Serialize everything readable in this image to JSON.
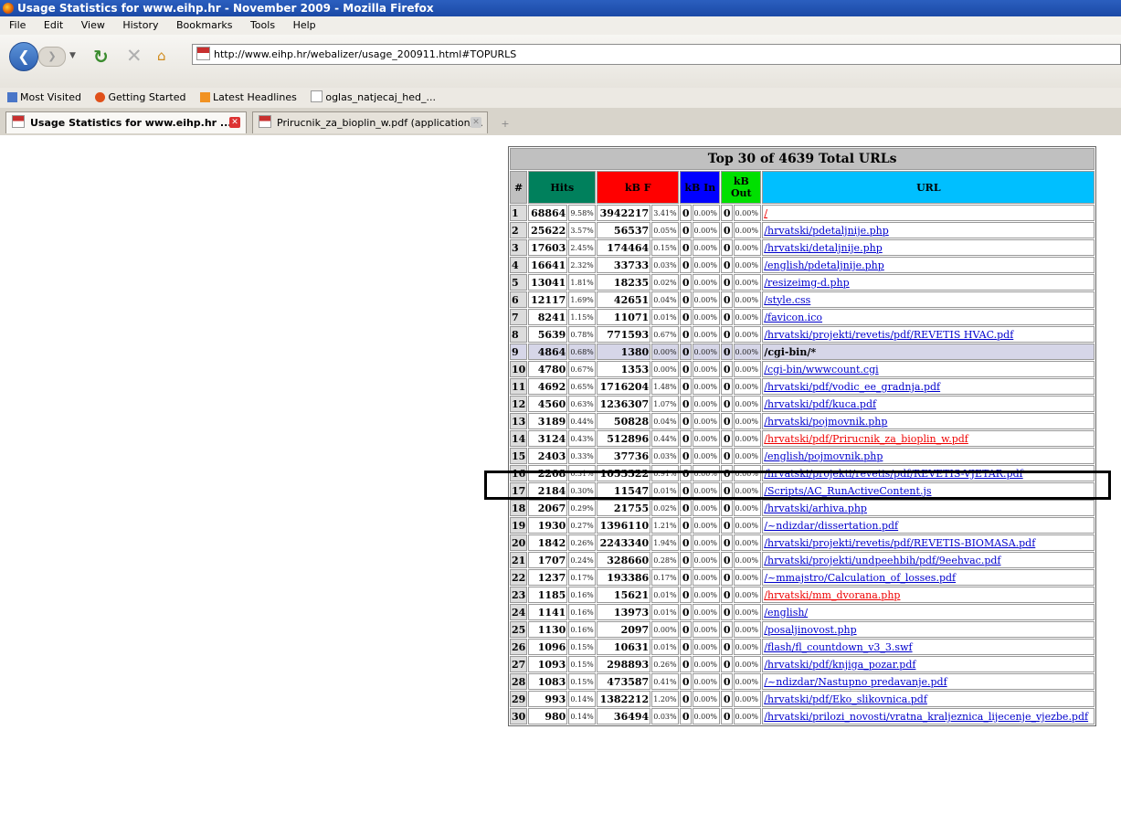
{
  "window": {
    "title": "Usage Statistics for www.eihp.hr - November 2009 - Mozilla Firefox"
  },
  "menu": [
    "File",
    "Edit",
    "View",
    "History",
    "Bookmarks",
    "Tools",
    "Help"
  ],
  "nav": {
    "url": "http://www.eihp.hr/webalizer/usage_200911.html#TOPURLS"
  },
  "bookmarks": [
    "Most Visited",
    "Getting Started",
    "Latest Headlines",
    "oglas_natjecaj_hed_..."
  ],
  "tabs": [
    {
      "label": "Usage Statistics for www.eihp.hr ...",
      "active": true
    },
    {
      "label": "Prirucnik_za_bioplin_w.pdf (application/...",
      "active": false
    }
  ],
  "newtab": "+",
  "table": {
    "caption": "Top 30 of 4639 Total URLs",
    "headers": {
      "num": "#",
      "hits": "Hits",
      "kbf": "kB F",
      "kbin": "kB In",
      "kbout": "kB Out",
      "url": "URL"
    },
    "rows": [
      {
        "n": "1",
        "hits": "68864",
        "hp": "9.58%",
        "kbf": "3942217",
        "kp": "3.41%",
        "in": "0",
        "ip": "0.00%",
        "out": "0",
        "op": "0.00%",
        "url": "/",
        "red": true
      },
      {
        "n": "2",
        "hits": "25622",
        "hp": "3.57%",
        "kbf": "56537",
        "kp": "0.05%",
        "in": "0",
        "ip": "0.00%",
        "out": "0",
        "op": "0.00%",
        "url": "/hrvatski/pdetaljnije.php"
      },
      {
        "n": "3",
        "hits": "17603",
        "hp": "2.45%",
        "kbf": "174464",
        "kp": "0.15%",
        "in": "0",
        "ip": "0.00%",
        "out": "0",
        "op": "0.00%",
        "url": "/hrvatski/detaljnije.php"
      },
      {
        "n": "4",
        "hits": "16641",
        "hp": "2.32%",
        "kbf": "33733",
        "kp": "0.03%",
        "in": "0",
        "ip": "0.00%",
        "out": "0",
        "op": "0.00%",
        "url": "/english/pdetaljnije.php"
      },
      {
        "n": "5",
        "hits": "13041",
        "hp": "1.81%",
        "kbf": "18235",
        "kp": "0.02%",
        "in": "0",
        "ip": "0.00%",
        "out": "0",
        "op": "0.00%",
        "url": "/resizeimg-d.php"
      },
      {
        "n": "6",
        "hits": "12117",
        "hp": "1.69%",
        "kbf": "42651",
        "kp": "0.04%",
        "in": "0",
        "ip": "0.00%",
        "out": "0",
        "op": "0.00%",
        "url": "/style.css"
      },
      {
        "n": "7",
        "hits": "8241",
        "hp": "1.15%",
        "kbf": "11071",
        "kp": "0.01%",
        "in": "0",
        "ip": "0.00%",
        "out": "0",
        "op": "0.00%",
        "url": "/favicon.ico"
      },
      {
        "n": "8",
        "hits": "5639",
        "hp": "0.78%",
        "kbf": "771593",
        "kp": "0.67%",
        "in": "0",
        "ip": "0.00%",
        "out": "0",
        "op": "0.00%",
        "url": "/hrvatski/projekti/revetis/pdf/REVETIS HVAC.pdf"
      },
      {
        "n": "9",
        "hits": "4864",
        "hp": "0.68%",
        "kbf": "1380",
        "kp": "0.00%",
        "in": "0",
        "ip": "0.00%",
        "out": "0",
        "op": "0.00%",
        "url": "/cgi-bin/*",
        "grey": true
      },
      {
        "n": "10",
        "hits": "4780",
        "hp": "0.67%",
        "kbf": "1353",
        "kp": "0.00%",
        "in": "0",
        "ip": "0.00%",
        "out": "0",
        "op": "0.00%",
        "url": "/cgi-bin/wwwcount.cgi"
      },
      {
        "n": "11",
        "hits": "4692",
        "hp": "0.65%",
        "kbf": "1716204",
        "kp": "1.48%",
        "in": "0",
        "ip": "0.00%",
        "out": "0",
        "op": "0.00%",
        "url": "/hrvatski/pdf/vodic_ee_gradnja.pdf"
      },
      {
        "n": "12",
        "hits": "4560",
        "hp": "0.63%",
        "kbf": "1236307",
        "kp": "1.07%",
        "in": "0",
        "ip": "0.00%",
        "out": "0",
        "op": "0.00%",
        "url": "/hrvatski/pdf/kuca.pdf"
      },
      {
        "n": "13",
        "hits": "3189",
        "hp": "0.44%",
        "kbf": "50828",
        "kp": "0.04%",
        "in": "0",
        "ip": "0.00%",
        "out": "0",
        "op": "0.00%",
        "url": "/hrvatski/pojmovnik.php"
      },
      {
        "n": "14",
        "hits": "3124",
        "hp": "0.43%",
        "kbf": "512896",
        "kp": "0.44%",
        "in": "0",
        "ip": "0.00%",
        "out": "0",
        "op": "0.00%",
        "url": "/hrvatski/pdf/Prirucnik_za_bioplin_w.pdf",
        "red": true
      },
      {
        "n": "15",
        "hits": "2403",
        "hp": "0.33%",
        "kbf": "37736",
        "kp": "0.03%",
        "in": "0",
        "ip": "0.00%",
        "out": "0",
        "op": "0.00%",
        "url": "/english/pojmovnik.php"
      },
      {
        "n": "16",
        "hits": "2208",
        "hp": "0.31%",
        "kbf": "1053322",
        "kp": "0.91%",
        "in": "0",
        "ip": "0.00%",
        "out": "0",
        "op": "0.00%",
        "url": "/hrvatski/projekti/revetis/pdf/REVETIS-VJETAR.pdf"
      },
      {
        "n": "17",
        "hits": "2184",
        "hp": "0.30%",
        "kbf": "11547",
        "kp": "0.01%",
        "in": "0",
        "ip": "0.00%",
        "out": "0",
        "op": "0.00%",
        "url": "/Scripts/AC_RunActiveContent.js"
      },
      {
        "n": "18",
        "hits": "2067",
        "hp": "0.29%",
        "kbf": "21755",
        "kp": "0.02%",
        "in": "0",
        "ip": "0.00%",
        "out": "0",
        "op": "0.00%",
        "url": "/hrvatski/arhiva.php"
      },
      {
        "n": "19",
        "hits": "1930",
        "hp": "0.27%",
        "kbf": "1396110",
        "kp": "1.21%",
        "in": "0",
        "ip": "0.00%",
        "out": "0",
        "op": "0.00%",
        "url": "/~ndizdar/dissertation.pdf"
      },
      {
        "n": "20",
        "hits": "1842",
        "hp": "0.26%",
        "kbf": "2243340",
        "kp": "1.94%",
        "in": "0",
        "ip": "0.00%",
        "out": "0",
        "op": "0.00%",
        "url": "/hrvatski/projekti/revetis/pdf/REVETIS-BIOMASA.pdf"
      },
      {
        "n": "21",
        "hits": "1707",
        "hp": "0.24%",
        "kbf": "328660",
        "kp": "0.28%",
        "in": "0",
        "ip": "0.00%",
        "out": "0",
        "op": "0.00%",
        "url": "/hrvatski/projekti/undpeehbih/pdf/9eehvac.pdf"
      },
      {
        "n": "22",
        "hits": "1237",
        "hp": "0.17%",
        "kbf": "193386",
        "kp": "0.17%",
        "in": "0",
        "ip": "0.00%",
        "out": "0",
        "op": "0.00%",
        "url": "/~mmajstro/Calculation_of_losses.pdf"
      },
      {
        "n": "23",
        "hits": "1185",
        "hp": "0.16%",
        "kbf": "15621",
        "kp": "0.01%",
        "in": "0",
        "ip": "0.00%",
        "out": "0",
        "op": "0.00%",
        "url": "/hrvatski/mm_dvorana.php",
        "red": true
      },
      {
        "n": "24",
        "hits": "1141",
        "hp": "0.16%",
        "kbf": "13973",
        "kp": "0.01%",
        "in": "0",
        "ip": "0.00%",
        "out": "0",
        "op": "0.00%",
        "url": "/english/"
      },
      {
        "n": "25",
        "hits": "1130",
        "hp": "0.16%",
        "kbf": "2097",
        "kp": "0.00%",
        "in": "0",
        "ip": "0.00%",
        "out": "0",
        "op": "0.00%",
        "url": "/posaljinovost.php"
      },
      {
        "n": "26",
        "hits": "1096",
        "hp": "0.15%",
        "kbf": "10631",
        "kp": "0.01%",
        "in": "0",
        "ip": "0.00%",
        "out": "0",
        "op": "0.00%",
        "url": "/flash/fl_countdown_v3_3.swf"
      },
      {
        "n": "27",
        "hits": "1093",
        "hp": "0.15%",
        "kbf": "298893",
        "kp": "0.26%",
        "in": "0",
        "ip": "0.00%",
        "out": "0",
        "op": "0.00%",
        "url": "/hrvatski/pdf/knjiga_pozar.pdf"
      },
      {
        "n": "28",
        "hits": "1083",
        "hp": "0.15%",
        "kbf": "473587",
        "kp": "0.41%",
        "in": "0",
        "ip": "0.00%",
        "out": "0",
        "op": "0.00%",
        "url": "/~ndizdar/Nastupno predavanje.pdf"
      },
      {
        "n": "29",
        "hits": "993",
        "hp": "0.14%",
        "kbf": "1382212",
        "kp": "1.20%",
        "in": "0",
        "ip": "0.00%",
        "out": "0",
        "op": "0.00%",
        "url": "/hrvatski/pdf/Eko_slikovnica.pdf"
      },
      {
        "n": "30",
        "hits": "980",
        "hp": "0.14%",
        "kbf": "36494",
        "kp": "0.03%",
        "in": "0",
        "ip": "0.00%",
        "out": "0",
        "op": "0.00%",
        "url": "/hrvatski/prilozi_novosti/vratna_kraljeznica_lijecenje_vjezbe.pdf"
      }
    ]
  }
}
